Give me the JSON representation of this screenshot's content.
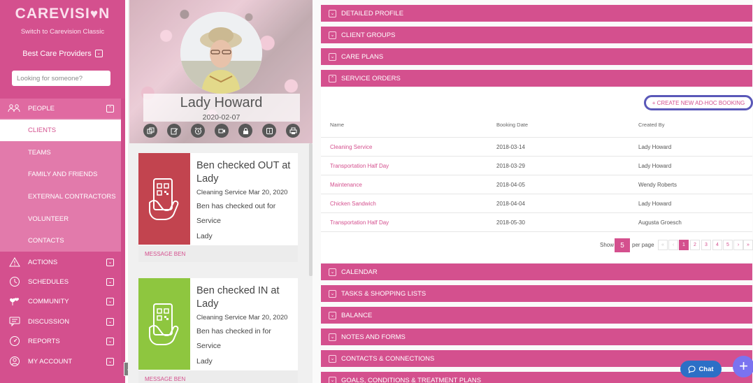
{
  "sidebar": {
    "logo_text": "CAREVISI",
    "logo_tail": "N",
    "switch_link": "Switch to Carevision Classic",
    "org_name": "Best Care Providers",
    "search_placeholder": "Looking for someone?",
    "people_label": "PEOPLE",
    "people_items": [
      "CLIENTS",
      "TEAMS",
      "FAMILY AND FRIENDS",
      "EXTERNAL CONTRACTORS",
      "VOLUNTEER",
      "CONTACTS"
    ],
    "active_item": "CLIENTS",
    "nav": [
      {
        "label": "ACTIONS",
        "icon": "warning-icon"
      },
      {
        "label": "SCHEDULES",
        "icon": "clock-icon"
      },
      {
        "label": "COMMUNITY",
        "icon": "hearts-icon"
      },
      {
        "label": "DISCUSSION",
        "icon": "chat-icon"
      },
      {
        "label": "REPORTS",
        "icon": "gauge-icon"
      },
      {
        "label": "MY ACCOUNT",
        "icon": "user-circle-icon"
      }
    ]
  },
  "profile": {
    "name": "Lady Howard",
    "date": "2020-02-07",
    "actions": [
      "link-icon",
      "edit-icon",
      "alarm-icon",
      "video-icon",
      "lock-icon",
      "info-icon",
      "print-icon"
    ]
  },
  "cards": [
    {
      "title": "Ben checked OUT at Lady",
      "meta": "Cleaning Service Mar 20, 2020",
      "desc": "Ben has checked out for Service",
      "desc2": "Lady",
      "footer": "MESSAGE BEN",
      "color": "#c2444f"
    },
    {
      "title": "Ben checked IN at Lady",
      "meta": "Cleaning Service Mar 20, 2020",
      "desc": "Ben has checked in for Service",
      "desc2": "Lady",
      "footer": "MESSAGE BEN",
      "color": "#8ec63f"
    }
  ],
  "sections_top": [
    "DETAILED PROFILE",
    "CLIENT GROUPS",
    "CARE PLANS",
    "SERVICE ORDERS"
  ],
  "service_orders": {
    "create_button": "+ CREATE NEW AD-HOC BOOKING",
    "columns": [
      "Name",
      "Booking Date",
      "Created By"
    ],
    "rows": [
      {
        "name": "Cleaning Service",
        "date": "2018-03-14",
        "by": "Lady Howard"
      },
      {
        "name": "Transportation Half Day",
        "date": "2018-03-29",
        "by": "Lady Howard"
      },
      {
        "name": "Maintenance",
        "date": "2018-04-05",
        "by": "Wendy Roberts"
      },
      {
        "name": "Chicken Sandwich",
        "date": "2018-04-04",
        "by": "Lady Howard"
      },
      {
        "name": "Transportation Half Day",
        "date": "2018-05-30",
        "by": "Augusta Groesch"
      }
    ],
    "show_label": "Show",
    "show_value": "5",
    "per_page_label": "per page",
    "pages": [
      "«",
      "‹",
      "1",
      "2",
      "3",
      "4",
      "5",
      "›",
      "»"
    ],
    "current_page": "1"
  },
  "sections_bottom": [
    "CALENDAR",
    "TASKS & SHOPPING LISTS",
    "BALANCE",
    "NOTES AND FORMS",
    "CONTACTS & CONNECTIONS",
    "GOALS, CONDITIONS & TREATMENT PLANS"
  ],
  "chat_label": "Chat",
  "colors": {
    "brand": "#d4508e",
    "chat": "#2c6fc6",
    "fab": "#7a73f0"
  }
}
